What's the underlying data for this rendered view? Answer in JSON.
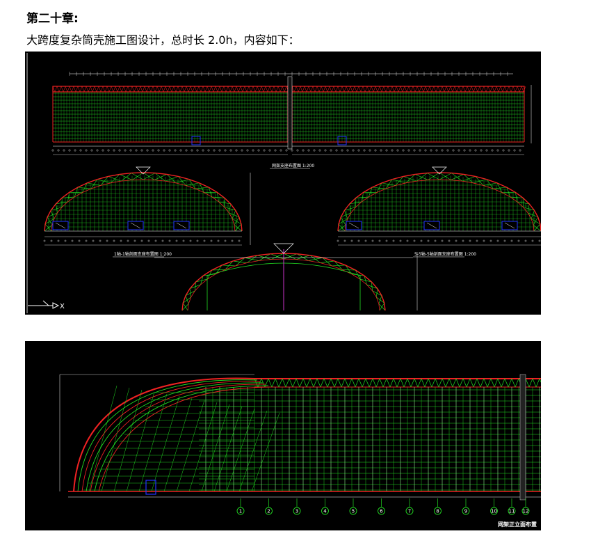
{
  "document": {
    "heading": "第二十章:",
    "subtitle": "大跨度复杂筒壳施工图设计，总时长 2.0h，内容如下："
  },
  "figure1": {
    "plan_caption": "网架支座布置图 1:200",
    "section_left_caption": "1轴-1轴剖面支座布置图 1:200",
    "section_right_caption": "5-5轴-5轴剖面支座布置图 1:200",
    "axis_label": "X"
  },
  "figure2": {
    "axis_numbers": [
      "1",
      "2",
      "3",
      "4",
      "5",
      "6",
      "7",
      "8",
      "9",
      "10",
      "11",
      "12"
    ],
    "caption": "网架正立面布置"
  },
  "colors": {
    "background": "#000000",
    "truss_green": "#22dd22",
    "chord_red": "#ee2222",
    "grid_white": "#ffffff",
    "support_blue": "#2233ff",
    "axis_magenta": "#cc33cc"
  }
}
